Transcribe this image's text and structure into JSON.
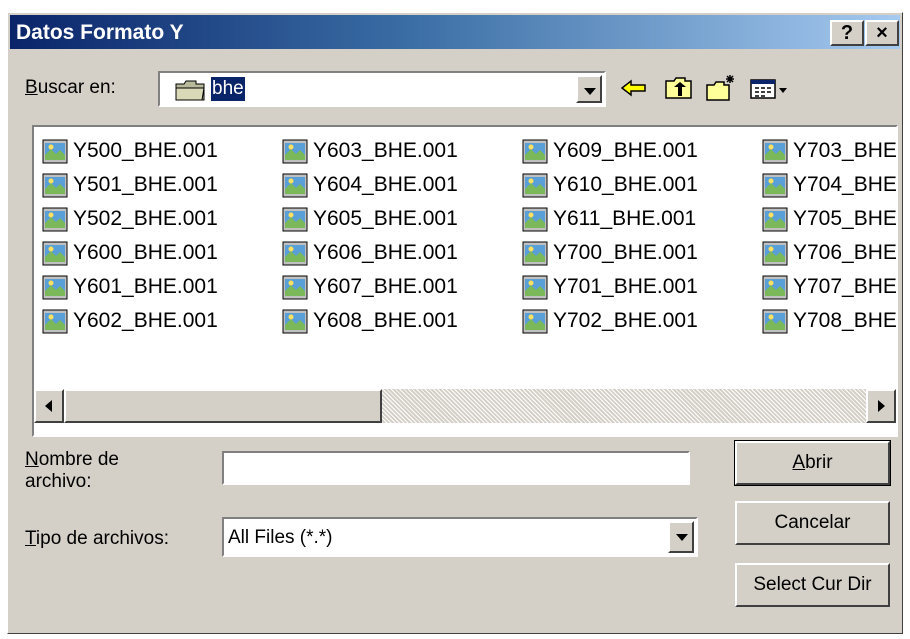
{
  "window": {
    "title": "Datos Formato Y",
    "help_label": "?",
    "close_label": "×"
  },
  "lookin": {
    "label_underlined": "B",
    "label_rest": "uscar en:",
    "value": "bhe"
  },
  "toolbar": {
    "icons": [
      "back-arrow-icon",
      "up-folder-icon",
      "new-folder-icon",
      "view-menu-icon"
    ]
  },
  "files": {
    "columns": [
      [
        "Y500_BHE.001",
        "Y501_BHE.001",
        "Y502_BHE.001",
        "Y600_BHE.001",
        "Y601_BHE.001",
        "Y602_BHE.001"
      ],
      [
        "Y603_BHE.001",
        "Y604_BHE.001",
        "Y605_BHE.001",
        "Y606_BHE.001",
        "Y607_BHE.001",
        "Y608_BHE.001"
      ],
      [
        "Y609_BHE.001",
        "Y610_BHE.001",
        "Y611_BHE.001",
        "Y700_BHE.001",
        "Y701_BHE.001",
        "Y702_BHE.001"
      ],
      [
        "Y703_BHE",
        "Y704_BHE",
        "Y705_BHE",
        "Y706_BHE",
        "Y707_BHE",
        "Y708_BHE"
      ]
    ]
  },
  "filename": {
    "label_underlined": "N",
    "label_line1_rest": "ombre de",
    "label_line2": "archivo:",
    "value": ""
  },
  "filetype": {
    "label_underlined": "T",
    "label_rest": "ipo de archivos:",
    "value": "All Files (*.*)"
  },
  "buttons": {
    "open_underlined": "A",
    "open_rest": "brir",
    "cancel": "Cancelar",
    "select_dir": "Select Cur Dir"
  },
  "colors": {
    "titlebar_start": "#0a246a",
    "titlebar_end": "#a6caf0",
    "face": "#d4d0c8",
    "selection": "#0a246a"
  }
}
